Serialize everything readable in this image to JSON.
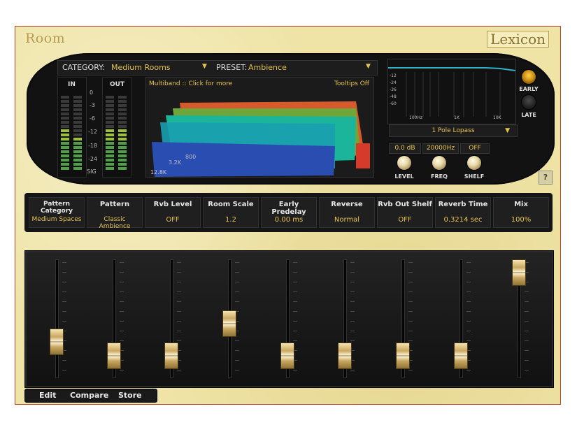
{
  "plugin": {
    "title": "Room",
    "brand": "Lexicon"
  },
  "category": {
    "label": "CATEGORY:",
    "value": "Medium Rooms"
  },
  "preset": {
    "label": "PRESET:",
    "value": "Ambience"
  },
  "meters": {
    "in_label": "IN",
    "out_label": "OUT",
    "scale": [
      "0",
      "-3",
      "-6",
      "-12",
      "-18",
      "-24",
      "SIG"
    ]
  },
  "spectrum": {
    "multiband_text": "Multiband :: Click for more",
    "tooltips_text": "Tooltips Off",
    "axis_12_8k": "12.8K",
    "axis_3_2k": "3.2K",
    "axis_800": "800"
  },
  "eq_display": {
    "db_ticks": [
      "-12",
      "-24",
      "-36",
      "-48",
      "-60"
    ],
    "freq_ticks": [
      "100Hz",
      "1K",
      "10K"
    ]
  },
  "filter": {
    "type": "1 Pole Lopass",
    "level_value": "0.0 dB",
    "freq_value": "20000Hz",
    "shelf_value": "OFF",
    "level_label": "LEVEL",
    "freq_label": "FREQ",
    "shelf_label": "SHELF"
  },
  "early_late": {
    "early_label": "EARLY",
    "late_label": "LATE",
    "help": "?"
  },
  "params": [
    {
      "header": "Pattern Category",
      "value": "Medium Spaces"
    },
    {
      "header": "Pattern",
      "value": "Classic Ambience"
    },
    {
      "header": "Rvb Level",
      "value": "OFF"
    },
    {
      "header": "Room Scale",
      "value": "1.2"
    },
    {
      "header": "Early Predelay",
      "value": "0.00 ms"
    },
    {
      "header": "Reverse",
      "value": "Normal"
    },
    {
      "header": "Rvb Out Shelf",
      "value": "OFF"
    },
    {
      "header": "Reverb Time",
      "value": "0.3214 sec"
    },
    {
      "header": "Mix",
      "value": "100%"
    }
  ],
  "slider_positions": [
    0.25,
    0.1,
    0.1,
    0.45,
    0.1,
    0.1,
    0.1,
    0.1,
    1.0
  ],
  "bottom_buttons": {
    "edit": "Edit",
    "compare": "Compare",
    "store": "Store"
  },
  "colors": {
    "accent": "#e7c349",
    "panel": "#efe4a6",
    "border": "#b8442c"
  }
}
